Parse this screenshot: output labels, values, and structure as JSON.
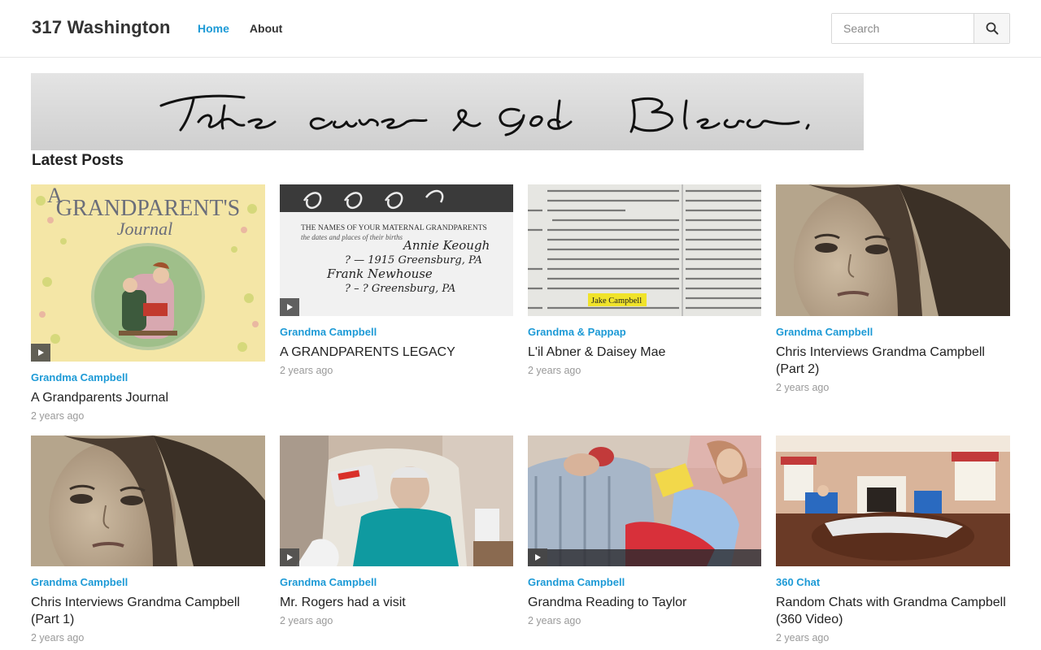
{
  "site": {
    "title": "317 Washington",
    "nav": [
      {
        "label": "Home",
        "active": true
      },
      {
        "label": "About",
        "active": false
      }
    ],
    "search": {
      "placeholder": "Search",
      "value": ""
    }
  },
  "banner": {
    "text": "Take care & God Bless."
  },
  "section_title": "Latest Posts",
  "posts": [
    {
      "category": "Grandma Campbell",
      "title": "A Grandparents Journal",
      "date": "2 years ago",
      "thumb": "journal-cover",
      "video": true
    },
    {
      "category": "Grandma Campbell",
      "title": "A GRANDPARENTS LEGACY",
      "date": "2 years ago",
      "thumb": "handwritten-page",
      "video": true
    },
    {
      "category": "Grandma & Pappap",
      "title": "L'il Abner & Daisey Mae",
      "date": "2 years ago",
      "thumb": "newspaper-clipping",
      "video": false
    },
    {
      "category": "Grandma Campbell",
      "title": "Chris Interviews Grandma Campbell (Part 2)",
      "date": "2 years ago",
      "thumb": "portrait",
      "video": false
    },
    {
      "category": "Grandma Campbell",
      "title": "Chris Interviews Grandma Campbell (Part 1)",
      "date": "2 years ago",
      "thumb": "portrait",
      "video": false
    },
    {
      "category": "Grandma Campbell",
      "title": "Mr. Rogers had a visit",
      "date": "2 years ago",
      "thumb": "grandma-recliner",
      "video": true
    },
    {
      "category": "Grandma Campbell",
      "title": "Grandma Reading to Taylor",
      "date": "2 years ago",
      "thumb": "reading-couch",
      "video": true
    },
    {
      "category": "360 Chat",
      "title": "Random Chats with Grandma Campbell (360 Video)",
      "date": "2 years ago",
      "thumb": "living-room-360",
      "video": false
    }
  ],
  "thumb_text": {
    "journal_title": "GRANDPARENT'S",
    "journal_sub": "Journal",
    "journal_letter": "A",
    "legacy_heading": "THE NAMES OF YOUR MATERNAL GRANDPARENTS",
    "legacy_sub": "the dates and places of their births",
    "legacy_hand": [
      "Annie Keough",
      "? — 1915 Greensburg, PA",
      "Frank Newhouse",
      "? – ? Greensburg, PA"
    ],
    "news_highlight": "Jake Campbell"
  },
  "colors": {
    "accent": "#1d9ad6"
  }
}
